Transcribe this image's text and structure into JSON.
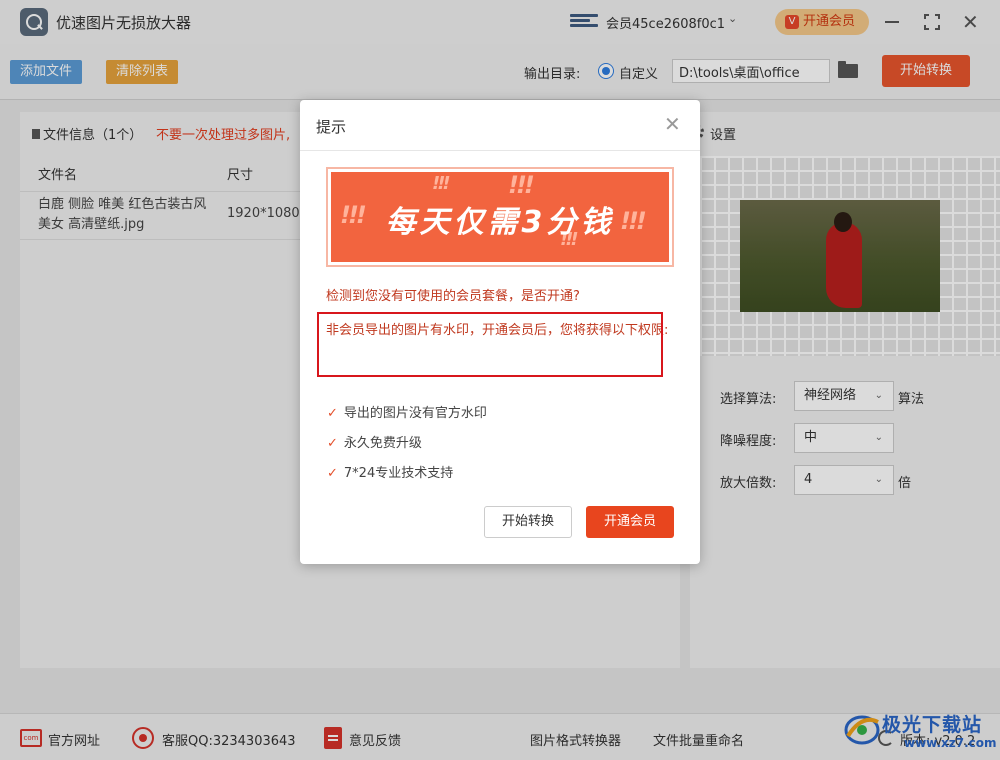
{
  "app": {
    "title": "优速图片无损放大器",
    "member_name": "会员45ce2608f0c1",
    "vip_button": "开通会员",
    "vip_badge": "V"
  },
  "toolbar": {
    "add_file": "添加文件",
    "clear_list": "清除列表",
    "output_label": "输出目录:",
    "custom_label": "自定义",
    "output_path": "D:\\tools\\桌面\\office",
    "start_convert": "开始转换"
  },
  "file_panel": {
    "info": "文件信息（1个）",
    "warning": "不要一次处理过多图片,",
    "columns": [
      "文件名",
      "尺寸"
    ],
    "rows": [
      {
        "name": "白鹿 侧脸 唯美 红色古装古风美女 高清壁纸.jpg",
        "size": "1920*1080"
      }
    ]
  },
  "settings": {
    "title": "设置",
    "algorithm_label": "选择算法:",
    "algorithm_value": "神经网络",
    "algorithm_suffix": "算法",
    "noise_label": "降噪程度:",
    "noise_value": "中",
    "scale_label": "放大倍数:",
    "scale_value": "4",
    "scale_suffix": "倍"
  },
  "dialog": {
    "title": "提示",
    "banner": "每天仅需3分钱",
    "banner_marks": "!!!",
    "question": "检测到您没有可使用的会员套餐，是否开通?",
    "highlight": "非会员导出的图片有水印，开通会员后，您将获得以下权限:",
    "perks": [
      "导出的图片没有官方水印",
      "永久免费升级",
      "7*24专业技术支持"
    ],
    "btn_start": "开始转换",
    "btn_vip": "开通会员"
  },
  "bottom": {
    "website": "官方网址",
    "website_icon_text": "com",
    "service_qq": "客服QQ:3234303643",
    "feedback": "意见反馈",
    "format_converter": "图片格式转换器",
    "batch_rename": "文件批量重命名",
    "version": "版本: v2.0.2"
  },
  "watermark": {
    "name": "极光下载站",
    "url": "www.xz7.com"
  },
  "colors": {
    "accent_orange": "#e8562d",
    "blue_button": "#5b9bd5",
    "amber_button": "#e6a23c",
    "highlight_red": "#d8161c"
  }
}
